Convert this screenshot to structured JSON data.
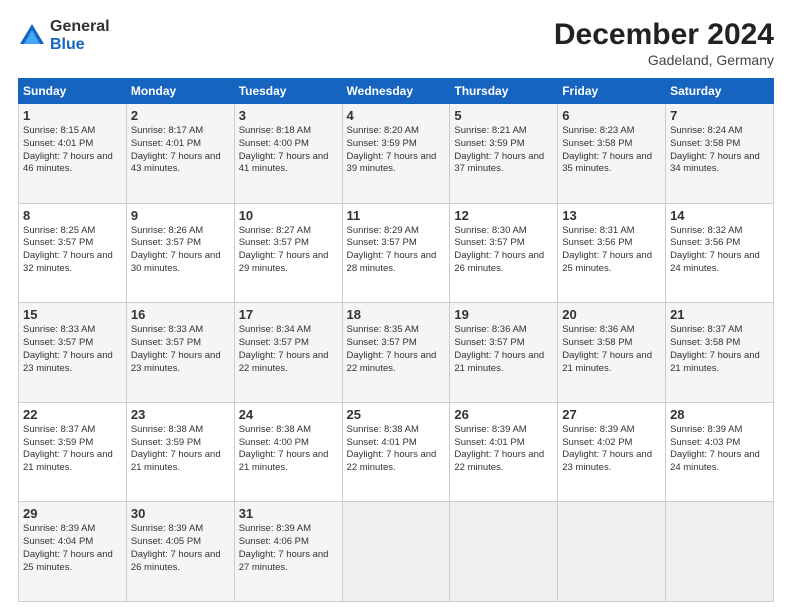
{
  "header": {
    "logo_general": "General",
    "logo_blue": "Blue",
    "month_title": "December 2024",
    "location": "Gadeland, Germany"
  },
  "days_of_week": [
    "Sunday",
    "Monday",
    "Tuesday",
    "Wednesday",
    "Thursday",
    "Friday",
    "Saturday"
  ],
  "weeks": [
    [
      {
        "day": "1",
        "sunrise": "Sunrise: 8:15 AM",
        "sunset": "Sunset: 4:01 PM",
        "daylight": "Daylight: 7 hours and 46 minutes."
      },
      {
        "day": "2",
        "sunrise": "Sunrise: 8:17 AM",
        "sunset": "Sunset: 4:01 PM",
        "daylight": "Daylight: 7 hours and 43 minutes."
      },
      {
        "day": "3",
        "sunrise": "Sunrise: 8:18 AM",
        "sunset": "Sunset: 4:00 PM",
        "daylight": "Daylight: 7 hours and 41 minutes."
      },
      {
        "day": "4",
        "sunrise": "Sunrise: 8:20 AM",
        "sunset": "Sunset: 3:59 PM",
        "daylight": "Daylight: 7 hours and 39 minutes."
      },
      {
        "day": "5",
        "sunrise": "Sunrise: 8:21 AM",
        "sunset": "Sunset: 3:59 PM",
        "daylight": "Daylight: 7 hours and 37 minutes."
      },
      {
        "day": "6",
        "sunrise": "Sunrise: 8:23 AM",
        "sunset": "Sunset: 3:58 PM",
        "daylight": "Daylight: 7 hours and 35 minutes."
      },
      {
        "day": "7",
        "sunrise": "Sunrise: 8:24 AM",
        "sunset": "Sunset: 3:58 PM",
        "daylight": "Daylight: 7 hours and 34 minutes."
      }
    ],
    [
      {
        "day": "8",
        "sunrise": "Sunrise: 8:25 AM",
        "sunset": "Sunset: 3:57 PM",
        "daylight": "Daylight: 7 hours and 32 minutes."
      },
      {
        "day": "9",
        "sunrise": "Sunrise: 8:26 AM",
        "sunset": "Sunset: 3:57 PM",
        "daylight": "Daylight: 7 hours and 30 minutes."
      },
      {
        "day": "10",
        "sunrise": "Sunrise: 8:27 AM",
        "sunset": "Sunset: 3:57 PM",
        "daylight": "Daylight: 7 hours and 29 minutes."
      },
      {
        "day": "11",
        "sunrise": "Sunrise: 8:29 AM",
        "sunset": "Sunset: 3:57 PM",
        "daylight": "Daylight: 7 hours and 28 minutes."
      },
      {
        "day": "12",
        "sunrise": "Sunrise: 8:30 AM",
        "sunset": "Sunset: 3:57 PM",
        "daylight": "Daylight: 7 hours and 26 minutes."
      },
      {
        "day": "13",
        "sunrise": "Sunrise: 8:31 AM",
        "sunset": "Sunset: 3:56 PM",
        "daylight": "Daylight: 7 hours and 25 minutes."
      },
      {
        "day": "14",
        "sunrise": "Sunrise: 8:32 AM",
        "sunset": "Sunset: 3:56 PM",
        "daylight": "Daylight: 7 hours and 24 minutes."
      }
    ],
    [
      {
        "day": "15",
        "sunrise": "Sunrise: 8:33 AM",
        "sunset": "Sunset: 3:57 PM",
        "daylight": "Daylight: 7 hours and 23 minutes."
      },
      {
        "day": "16",
        "sunrise": "Sunrise: 8:33 AM",
        "sunset": "Sunset: 3:57 PM",
        "daylight": "Daylight: 7 hours and 23 minutes."
      },
      {
        "day": "17",
        "sunrise": "Sunrise: 8:34 AM",
        "sunset": "Sunset: 3:57 PM",
        "daylight": "Daylight: 7 hours and 22 minutes."
      },
      {
        "day": "18",
        "sunrise": "Sunrise: 8:35 AM",
        "sunset": "Sunset: 3:57 PM",
        "daylight": "Daylight: 7 hours and 22 minutes."
      },
      {
        "day": "19",
        "sunrise": "Sunrise: 8:36 AM",
        "sunset": "Sunset: 3:57 PM",
        "daylight": "Daylight: 7 hours and 21 minutes."
      },
      {
        "day": "20",
        "sunrise": "Sunrise: 8:36 AM",
        "sunset": "Sunset: 3:58 PM",
        "daylight": "Daylight: 7 hours and 21 minutes."
      },
      {
        "day": "21",
        "sunrise": "Sunrise: 8:37 AM",
        "sunset": "Sunset: 3:58 PM",
        "daylight": "Daylight: 7 hours and 21 minutes."
      }
    ],
    [
      {
        "day": "22",
        "sunrise": "Sunrise: 8:37 AM",
        "sunset": "Sunset: 3:59 PM",
        "daylight": "Daylight: 7 hours and 21 minutes."
      },
      {
        "day": "23",
        "sunrise": "Sunrise: 8:38 AM",
        "sunset": "Sunset: 3:59 PM",
        "daylight": "Daylight: 7 hours and 21 minutes."
      },
      {
        "day": "24",
        "sunrise": "Sunrise: 8:38 AM",
        "sunset": "Sunset: 4:00 PM",
        "daylight": "Daylight: 7 hours and 21 minutes."
      },
      {
        "day": "25",
        "sunrise": "Sunrise: 8:38 AM",
        "sunset": "Sunset: 4:01 PM",
        "daylight": "Daylight: 7 hours and 22 minutes."
      },
      {
        "day": "26",
        "sunrise": "Sunrise: 8:39 AM",
        "sunset": "Sunset: 4:01 PM",
        "daylight": "Daylight: 7 hours and 22 minutes."
      },
      {
        "day": "27",
        "sunrise": "Sunrise: 8:39 AM",
        "sunset": "Sunset: 4:02 PM",
        "daylight": "Daylight: 7 hours and 23 minutes."
      },
      {
        "day": "28",
        "sunrise": "Sunrise: 8:39 AM",
        "sunset": "Sunset: 4:03 PM",
        "daylight": "Daylight: 7 hours and 24 minutes."
      }
    ],
    [
      {
        "day": "29",
        "sunrise": "Sunrise: 8:39 AM",
        "sunset": "Sunset: 4:04 PM",
        "daylight": "Daylight: 7 hours and 25 minutes."
      },
      {
        "day": "30",
        "sunrise": "Sunrise: 8:39 AM",
        "sunset": "Sunset: 4:05 PM",
        "daylight": "Daylight: 7 hours and 26 minutes."
      },
      {
        "day": "31",
        "sunrise": "Sunrise: 8:39 AM",
        "sunset": "Sunset: 4:06 PM",
        "daylight": "Daylight: 7 hours and 27 minutes."
      },
      null,
      null,
      null,
      null
    ]
  ]
}
